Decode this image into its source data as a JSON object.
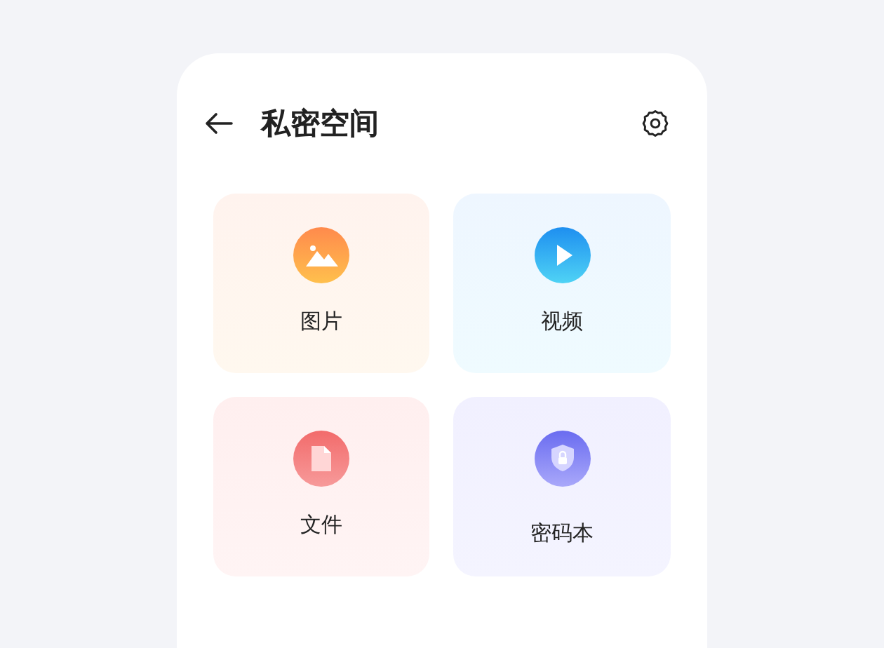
{
  "header": {
    "title": "私密空间"
  },
  "cards": [
    {
      "kind": "picture",
      "label": "图片"
    },
    {
      "kind": "video",
      "label": "视频"
    },
    {
      "kind": "file",
      "label": "文件"
    },
    {
      "kind": "password",
      "label": "密码本"
    }
  ]
}
